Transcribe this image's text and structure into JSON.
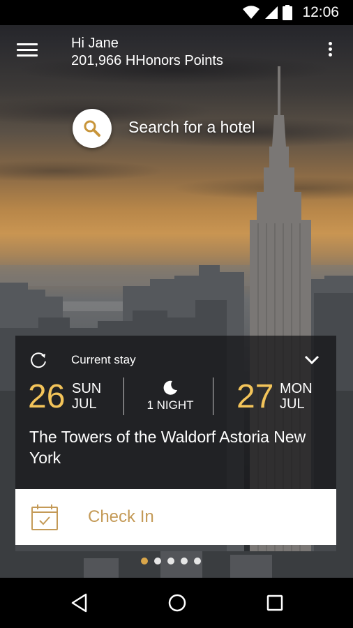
{
  "status_bar": {
    "time": "12:06",
    "icons": [
      "wifi-icon",
      "cell-signal-icon",
      "battery-icon"
    ]
  },
  "header": {
    "menu_icon": "hamburger-menu-icon",
    "greeting": "Hi Jane",
    "points": "201,966 HHonors Points",
    "overflow_icon": "more-vert-icon"
  },
  "search": {
    "icon": "search-icon",
    "label": "Search for a hotel"
  },
  "stay_card": {
    "label": "Current stay",
    "refresh_icon": "refresh-icon",
    "expand_icon": "chevron-down-icon",
    "check_in": {
      "day": "26",
      "weekday": "SUN",
      "month": "JUL"
    },
    "nights": {
      "icon": "moon-icon",
      "label": "1 NIGHT"
    },
    "check_out": {
      "day": "27",
      "weekday": "MON",
      "month": "JUL"
    },
    "hotel_name": "The Towers of the Waldorf Astoria New York"
  },
  "check_in_button": {
    "icon": "calendar-check-icon",
    "label": "Check In"
  },
  "pager": {
    "count": 5,
    "active_index": 0
  },
  "nav_bar": {
    "icons": [
      "back-icon",
      "home-icon",
      "recents-icon"
    ]
  },
  "colors": {
    "accent": "#f3c45a",
    "checkin_text": "#c49a57",
    "card_bg": "#141416"
  }
}
